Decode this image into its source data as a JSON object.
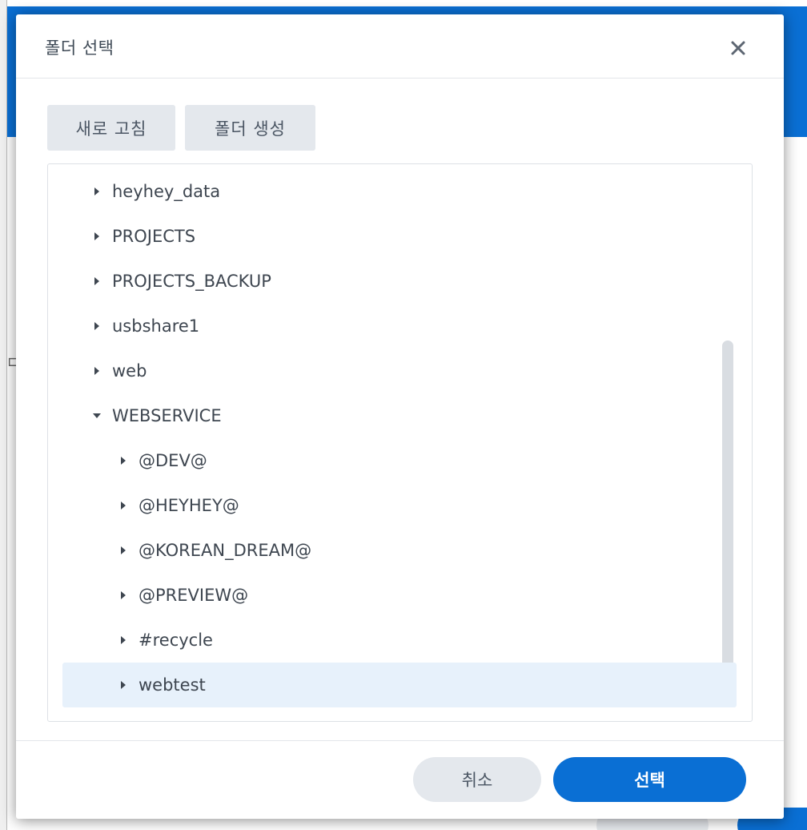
{
  "dialog": {
    "title": "폴더 선택",
    "close_icon": "close-icon"
  },
  "toolbar": {
    "refresh_label": "새로 고침",
    "create_folder_label": "폴더 생성"
  },
  "tree": {
    "items": [
      {
        "label": "heyhey_data",
        "depth": 0,
        "expanded": false,
        "selected": false
      },
      {
        "label": "PROJECTS",
        "depth": 0,
        "expanded": false,
        "selected": false
      },
      {
        "label": "PROJECTS_BACKUP",
        "depth": 0,
        "expanded": false,
        "selected": false
      },
      {
        "label": "usbshare1",
        "depth": 0,
        "expanded": false,
        "selected": false
      },
      {
        "label": "web",
        "depth": 0,
        "expanded": false,
        "selected": false
      },
      {
        "label": "WEBSERVICE",
        "depth": 0,
        "expanded": true,
        "selected": false
      },
      {
        "label": "@DEV@",
        "depth": 1,
        "expanded": false,
        "selected": false
      },
      {
        "label": "@HEYHEY@",
        "depth": 1,
        "expanded": false,
        "selected": false
      },
      {
        "label": "@KOREAN_DREAM@",
        "depth": 1,
        "expanded": false,
        "selected": false
      },
      {
        "label": "@PREVIEW@",
        "depth": 1,
        "expanded": false,
        "selected": false
      },
      {
        "label": "#recycle",
        "depth": 1,
        "expanded": false,
        "selected": false
      },
      {
        "label": "webtest",
        "depth": 1,
        "expanded": false,
        "selected": true
      }
    ]
  },
  "footer": {
    "cancel_label": "취소",
    "select_label": "선택"
  },
  "colors": {
    "accent": "#0a6fd4",
    "selected_row": "#e7f1fb",
    "button_gray": "#e4e8ed"
  }
}
